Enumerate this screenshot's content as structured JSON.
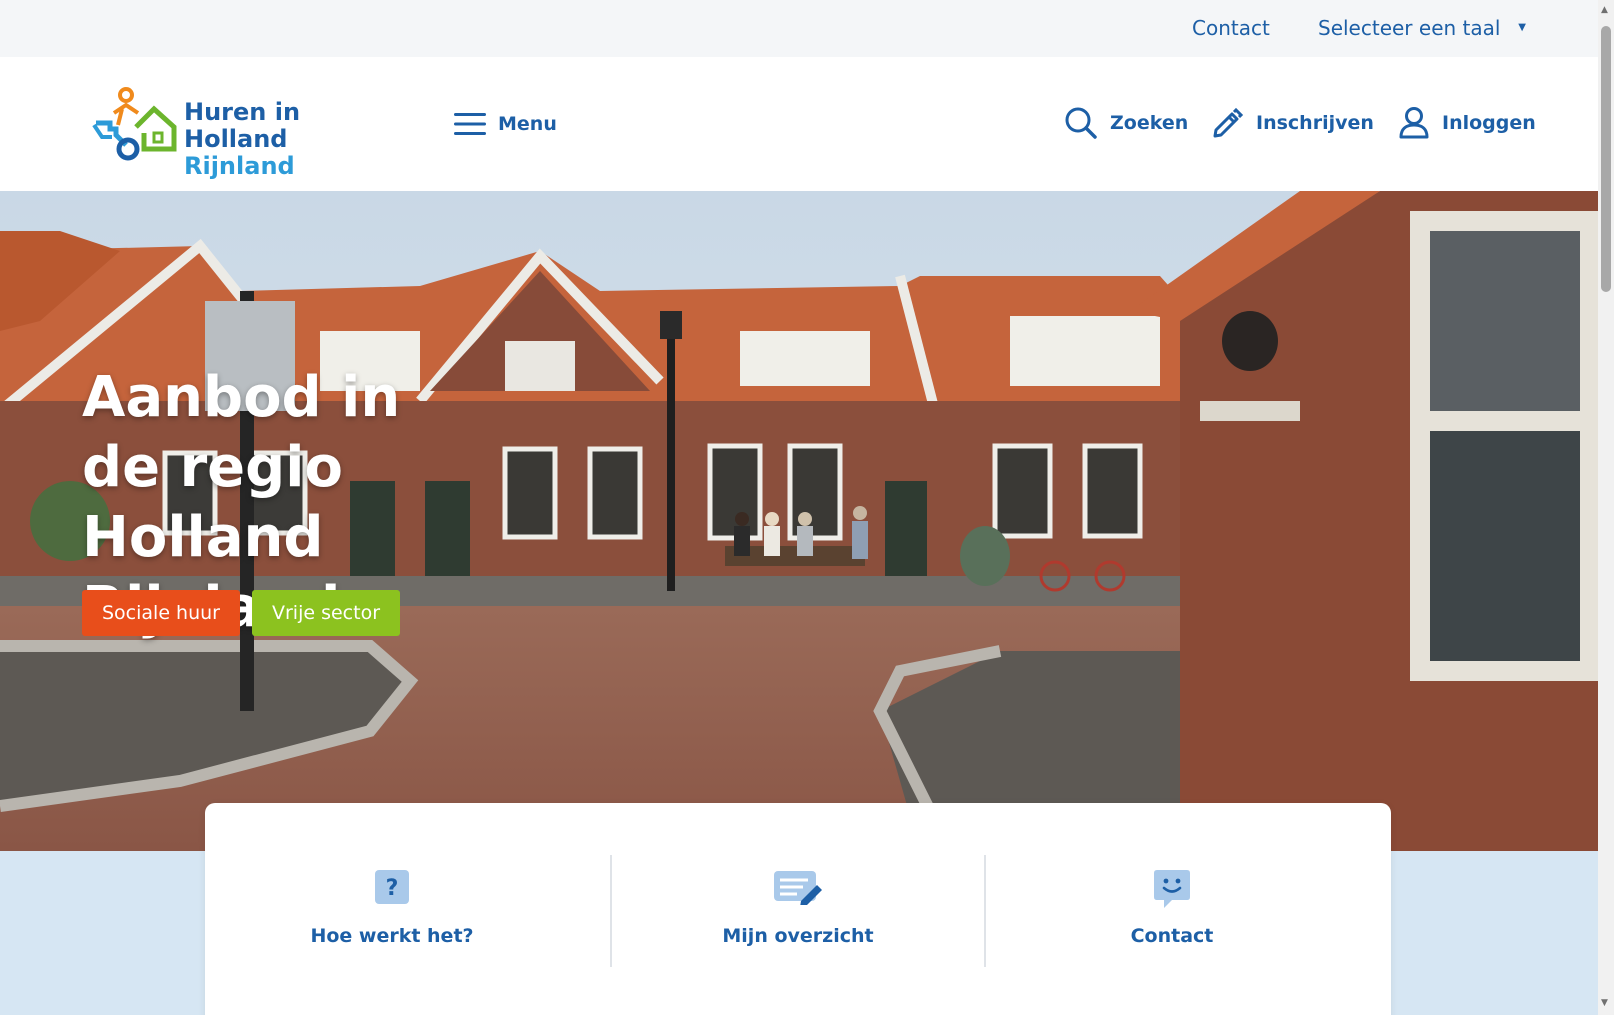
{
  "topbar": {
    "contact": "Contact",
    "language": "Selecteer een taal"
  },
  "header": {
    "logo_line1": "Huren in",
    "logo_line2a": "Holland",
    "logo_line2b": "Rijnland",
    "menu": "Menu",
    "search": "Zoeken",
    "signup": "Inschrijven",
    "login": "Inloggen"
  },
  "hero": {
    "title_line1": "Aanbod in",
    "title_line2": "de regio Holland",
    "title_line3": "Rijnland",
    "btn_social": "Sociale huur",
    "btn_free": "Vrije sector"
  },
  "quicklinks": [
    {
      "label": "Hoe werkt het?",
      "icon": "question-icon"
    },
    {
      "label": "Mijn overzicht",
      "icon": "edit-document-icon"
    },
    {
      "label": "Contact",
      "icon": "chat-smiley-icon"
    }
  ],
  "colors": {
    "brand_blue": "#1d5fa6",
    "light_blue": "#2d9bd8",
    "orange": "#e84e1b",
    "green": "#8cc21f",
    "page_bg": "#d6e6f3"
  }
}
